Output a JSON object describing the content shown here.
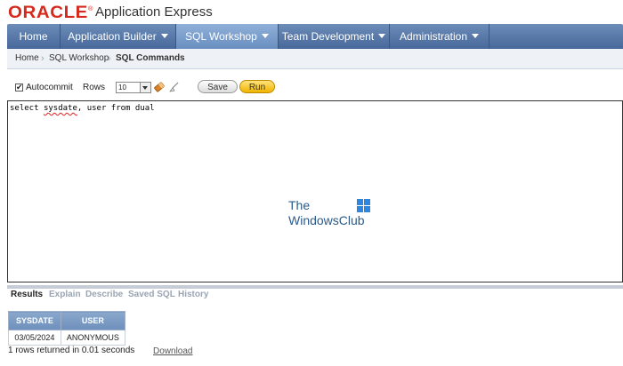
{
  "header": {
    "logo": "ORACLE",
    "registered": "®",
    "app_name": "Application Express"
  },
  "nav": {
    "tabs": [
      {
        "label": "Home",
        "dropdown": false,
        "active": false
      },
      {
        "label": "Application Builder",
        "dropdown": true,
        "active": false
      },
      {
        "label": "SQL Workshop",
        "dropdown": true,
        "active": true
      },
      {
        "label": "Team Development",
        "dropdown": true,
        "active": false
      },
      {
        "label": "Administration",
        "dropdown": true,
        "active": false
      }
    ]
  },
  "breadcrumb": {
    "items": [
      "Home",
      "SQL Workshop",
      "SQL Commands"
    ]
  },
  "toolbar": {
    "autocommit_label": "Autocommit",
    "autocommit_checked": true,
    "rows_label": "Rows",
    "rows_value": "10",
    "save_label": "Save",
    "run_label": "Run"
  },
  "editor": {
    "code_before": "select ",
    "code_misspelled": "sysdate",
    "code_after": ", user from dual"
  },
  "watermark": {
    "line1": "The",
    "line2": "WindowsClub"
  },
  "result_tabs": {
    "items": [
      "Results",
      "Explain",
      "Describe",
      "Saved SQL",
      "History"
    ],
    "active": "Results"
  },
  "results": {
    "columns": [
      "SYSDATE",
      "USER"
    ],
    "rows": [
      [
        "03/05/2024",
        "ANONYMOUS"
      ]
    ],
    "summary": "1 rows returned in 0.01 seconds",
    "download_label": "Download"
  },
  "colors": {
    "oracle_red": "#d52b1e",
    "nav_blue": "#47689a",
    "run_yellow": "#f0b400"
  }
}
